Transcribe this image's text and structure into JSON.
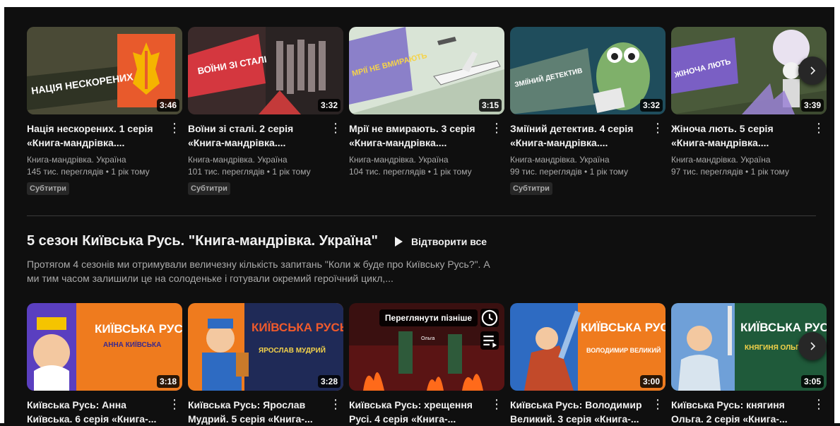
{
  "shelf1": {
    "videos": [
      {
        "title": "Нація нескорених. 1 серія «Книга-мандрівка....",
        "channel": "Книга-мандрівка. Україна",
        "views": "145 тис. переглядів • 1 рік тому",
        "duration": "3:46",
        "badge": "Субтитри",
        "thumb_text": "НАЦІЯ НЕСКОРЕНИХ"
      },
      {
        "title": "Воїни зі сталі. 2 серія «Книга-мандрівка....",
        "channel": "Книга-мандрівка. Україна",
        "views": "101 тис. переглядів • 1 рік тому",
        "duration": "3:32",
        "badge": "Субтитри",
        "thumb_text": "ВОЇНИ ЗІ СТАЛІ"
      },
      {
        "title": "Мрії не вмирають. 3 серія «Книга-мандрівка....",
        "channel": "Книга-мандрівка. Україна",
        "views": "104 тис. переглядів • 1 рік тому",
        "duration": "3:15",
        "badge": "",
        "thumb_text": "МРІЇ НЕ ВМИРАЮТЬ"
      },
      {
        "title": "Зміїний детектив. 4 серія «Книга-мандрівка....",
        "channel": "Книга-мандрівка. Україна",
        "views": "99 тис. переглядів • 1 рік тому",
        "duration": "3:32",
        "badge": "Субтитри",
        "thumb_text": "ЗМІЇНИЙ ДЕТЕКТИВ"
      },
      {
        "title": "Жіноча лють. 5 серія «Книга-мандрівка....",
        "channel": "Книга-мандрівка. Україна",
        "views": "97 тис. переглядів • 1 рік тому",
        "duration": "3:39",
        "badge": "",
        "thumb_text": "ЖІНОЧА ЛЮТЬ"
      }
    ]
  },
  "section2": {
    "title": "5 сезон Київська Русь. \"Книга-мандрівка. Україна\"",
    "play_all": "Відтворити все",
    "description": "Протягом 4 сезонів ми отримували величезну кількість запитань \"Коли ж буде про Київську Русь?\". А ми тим часом залишили це на солоденьке і готували окремий героїчний цикл,...",
    "watch_later": "Переглянути пізніше",
    "videos": [
      {
        "title": "Київська Русь: Анна Київська. 6 серія «Книга-...",
        "duration": "3:18",
        "thumb_title": "КИЇВСЬКА РУСЬ:",
        "thumb_sub": "АННА КИЇВСЬКА"
      },
      {
        "title": "Київська Русь: Ярослав Мудрий. 5 серія «Книга-...",
        "duration": "3:28",
        "thumb_title": "КИЇВСЬКА РУСЬ:",
        "thumb_sub": "ЯРОСЛАВ МУДРИЙ"
      },
      {
        "title": "Київська Русь: хрещення Русі. 4 серія «Книга-...",
        "duration": "",
        "thumb_title": "",
        "thumb_sub": "Ольга"
      },
      {
        "title": "Київська Русь: Володимир Великий. 3 серія «Книга-...",
        "duration": "3:00",
        "thumb_title": "КИЇВСЬКА РУСЬ:",
        "thumb_sub": "ВОЛОДИМИР ВЕЛИКИЙ"
      },
      {
        "title": "Київська Русь: княгиня Ольга. 2 серія «Книга-...",
        "duration": "3:05",
        "thumb_title": "КИЇВСЬКА РУСЬ:",
        "thumb_sub": "КНЯГИНЯ ОЛЬГ."
      }
    ]
  }
}
